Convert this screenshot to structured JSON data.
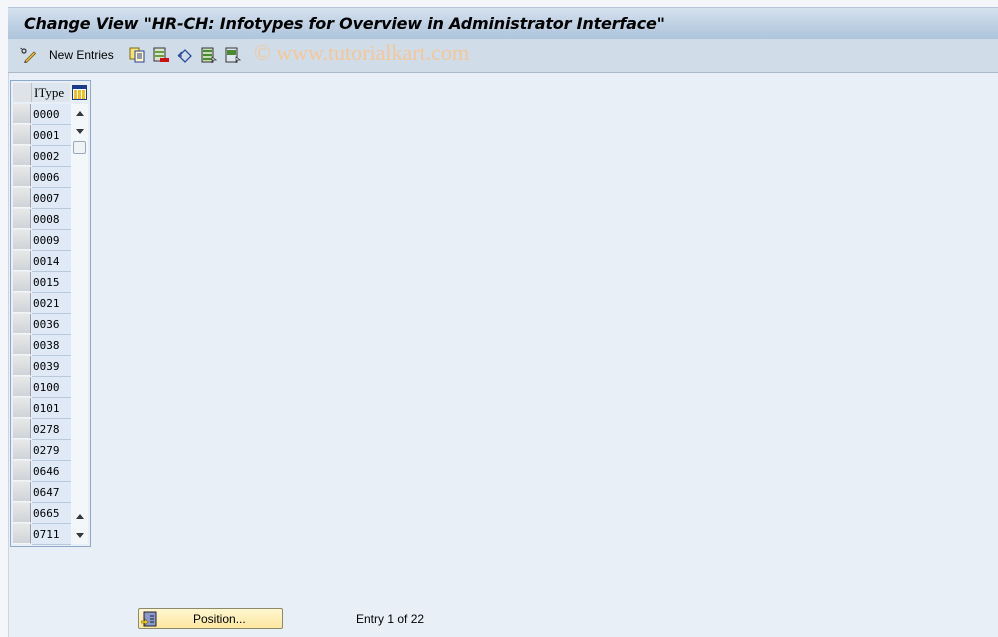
{
  "window": {
    "title": "Change View \"HR-CH: Infotypes for Overview in Administrator Interface\""
  },
  "toolbar": {
    "items": [
      {
        "icon": "display-change-icon",
        "label": ""
      },
      {
        "icon": "new-entries-label",
        "label": "New Entries"
      },
      {
        "icon": "copy-as-icon",
        "label": ""
      },
      {
        "icon": "delete-icon",
        "label": ""
      },
      {
        "icon": "undo-change-icon",
        "label": ""
      },
      {
        "icon": "select-all-icon",
        "label": ""
      },
      {
        "icon": "select-block-icon",
        "label": ""
      }
    ],
    "new_entries_label": "New Entries",
    "watermark": "© www.tutorialkart.com"
  },
  "table": {
    "column_header": "IType",
    "rows": [
      "0000",
      "0001",
      "0002",
      "0006",
      "0007",
      "0008",
      "0009",
      "0014",
      "0015",
      "0021",
      "0036",
      "0038",
      "0039",
      "0100",
      "0101",
      "0278",
      "0279",
      "0646",
      "0647",
      "0665",
      "0711"
    ]
  },
  "footer": {
    "position_button_label": "Position...",
    "entry_info": "Entry 1 of 22"
  },
  "colors": {
    "title_bar": "#bccfe2",
    "toolbar": "#d0dce7",
    "background": "#e8eff7",
    "position_button": "#fde7a0",
    "watermark": "#f3c79a"
  }
}
